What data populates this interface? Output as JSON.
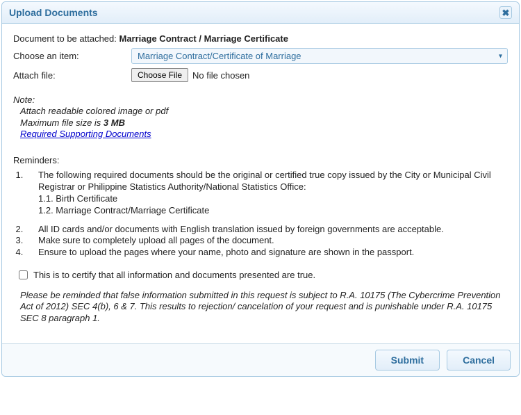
{
  "title": "Upload Documents",
  "doc_label": "Document to be attached:",
  "doc_value": "Marriage Contract / Marriage Certificate",
  "choose_label": "Choose an item:",
  "choose_selected": "Marriage Contract/Certificate of Marriage",
  "attach_label": "Attach file:",
  "file_button": "Choose File",
  "file_status": "No file chosen",
  "note": {
    "header": "Note:",
    "line1": "Attach readable colored image or pdf",
    "line2_a": "Maximum file size is ",
    "line2_b": "3 MB",
    "link": "Required Supporting Documents"
  },
  "reminders_header": "Reminders:",
  "reminders": {
    "r1": "The following required documents should be the original or certified true copy issued by the City or Municipal Civil Registrar or Philippine Statistics Authority/National Statistics Office:",
    "r1_1": "1.1. Birth Certificate",
    "r1_2": "1.2. Marriage Contract/Marriage Certificate",
    "r2": "All ID cards and/or documents with English translation issued by foreign governments are acceptable.",
    "r3": "Make sure to completely upload all pages of the document.",
    "r4": "Ensure to upload the pages where your name, photo and signature are shown in the passport."
  },
  "certify_label": "This is to certify that all information and documents presented are true.",
  "legal": "Please be reminded that false information submitted in this request is subject to R.A. 10175 (The Cybercrime Prevention Act of 2012) SEC 4(b), 6 & 7. This results to rejection/ cancelation of your request and is punishable under R.A. 10175 SEC 8 paragraph 1.",
  "buttons": {
    "submit": "Submit",
    "cancel": "Cancel"
  }
}
